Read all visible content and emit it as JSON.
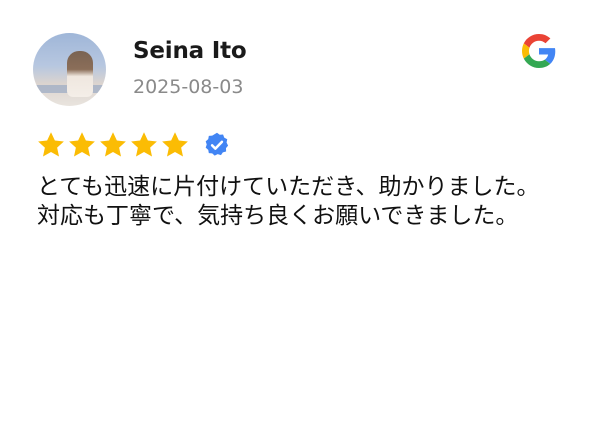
{
  "review": {
    "reviewer_name": "Seina Ito",
    "date": "2025-08-03",
    "rating": 5,
    "max_rating": 5,
    "text_lines": [
      "とても迅速に片付けていただき、助かりました。",
      "対応も丁寧で、気持ち良くお願いできました。"
    ]
  },
  "icons": {
    "source_logo": "google-g-logo",
    "star": "star-icon",
    "verified": "verified-badge-icon",
    "avatar": "reviewer-avatar-photo"
  },
  "colors": {
    "star": "#fbbc04",
    "verified": "#4285f4",
    "date": "#8a8a8a",
    "name": "#1a1a1a",
    "google_blue": "#4285f4",
    "google_red": "#ea4335",
    "google_yellow": "#fbbc05",
    "google_green": "#34a853"
  }
}
